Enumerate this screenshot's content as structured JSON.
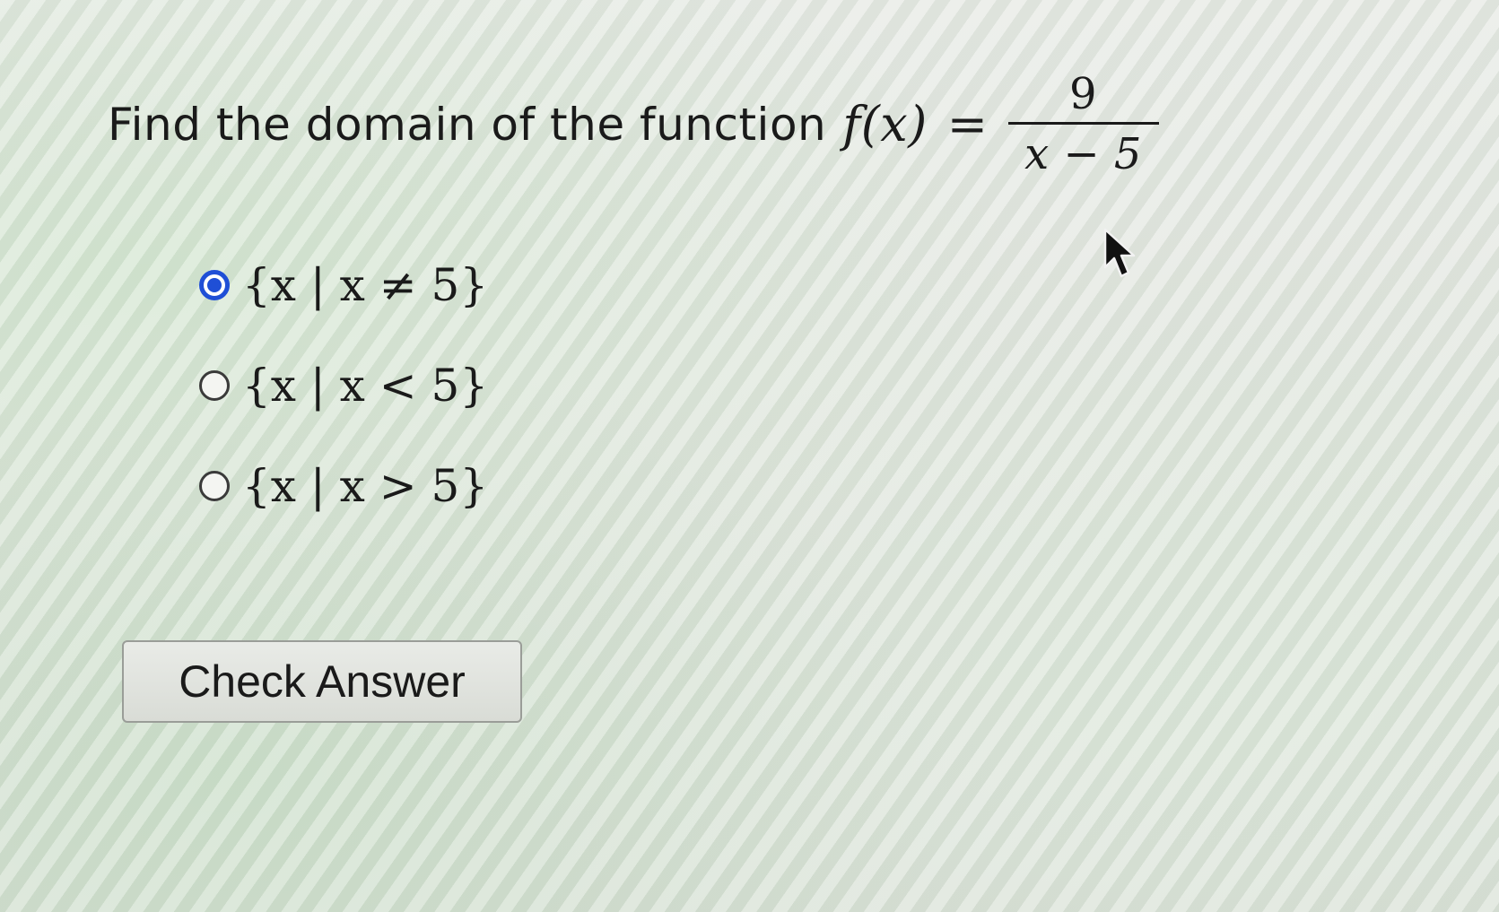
{
  "question": {
    "prompt": "Find the domain of the function",
    "function_lhs": "f(x)",
    "equals": "=",
    "numerator": "9",
    "denominator": "x − 5"
  },
  "options": [
    {
      "label": "{x | x ≠ 5}",
      "selected": true
    },
    {
      "label": "{x | x < 5}",
      "selected": false
    },
    {
      "label": "{x | x > 5}",
      "selected": false
    }
  ],
  "check_button": {
    "label": "Check Answer"
  },
  "colors": {
    "accent": "#1f4fd6"
  },
  "icons": {
    "cursor": "arrow-cursor-icon"
  }
}
